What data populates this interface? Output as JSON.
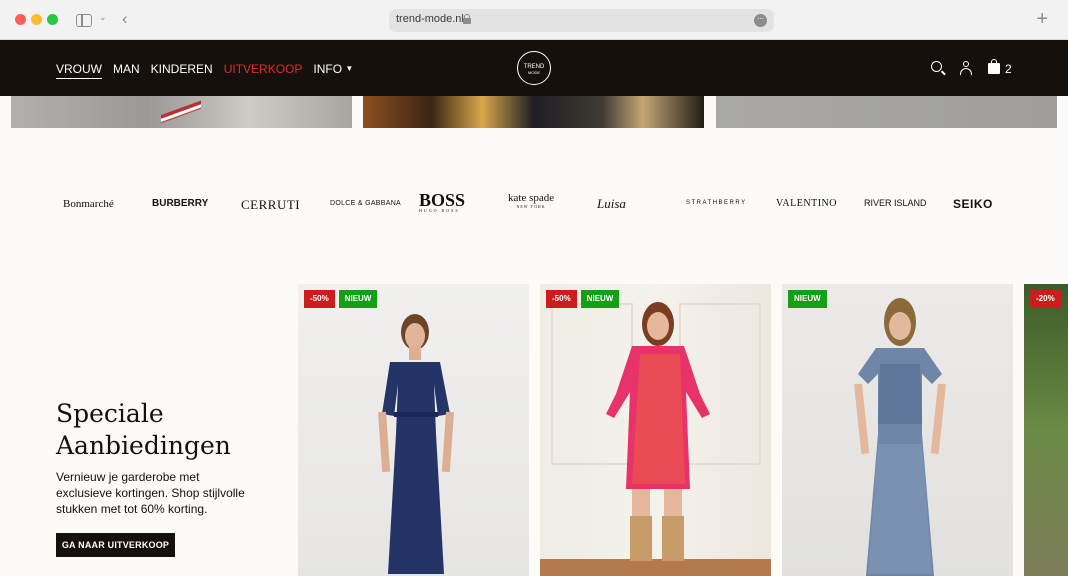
{
  "browser": {
    "url": "trend-mode.nl"
  },
  "header": {
    "nav": [
      {
        "label": "VROUW"
      },
      {
        "label": "MAN"
      },
      {
        "label": "KINDEREN"
      },
      {
        "label": "UITVERKOOP"
      },
      {
        "label": "INFO"
      }
    ],
    "logo_top": "TREND",
    "logo_bottom": "MODE",
    "cart_count": "2"
  },
  "brands": [
    {
      "name": "Bonmarché"
    },
    {
      "name": "BURBERRY"
    },
    {
      "name": "CERRUTI"
    },
    {
      "name": "DOLCE & GABBANA"
    },
    {
      "name": "BOSS",
      "sub": "HUGO BOSS"
    },
    {
      "name": "kate spade",
      "sub": "NEW YORK"
    },
    {
      "name": "Luisa"
    },
    {
      "name": "STRATHBERRY"
    },
    {
      "name": "VALENTINO"
    },
    {
      "name": "RIVER ISLAND"
    },
    {
      "name": "SEIKO"
    }
  ],
  "promo": {
    "title": "Speciale Aanbiedingen",
    "text": "Vernieuw je garderobe met exclusieve kortingen. Shop stijlvolle stukken met tot 60% korting.",
    "button": "GA NAAR UITVERKOOP"
  },
  "products": [
    {
      "badges": [
        "-50%",
        "NIEUW"
      ]
    },
    {
      "badges": [
        "-50%",
        "NIEUW"
      ]
    },
    {
      "badges": [
        "NIEUW"
      ]
    },
    {
      "badges": [
        "-20%"
      ]
    }
  ],
  "colors": {
    "header_bg": "#15100b",
    "sale_red": "#cc1d1d",
    "new_green": "#14a014",
    "page_bg": "#fdfbf7"
  }
}
